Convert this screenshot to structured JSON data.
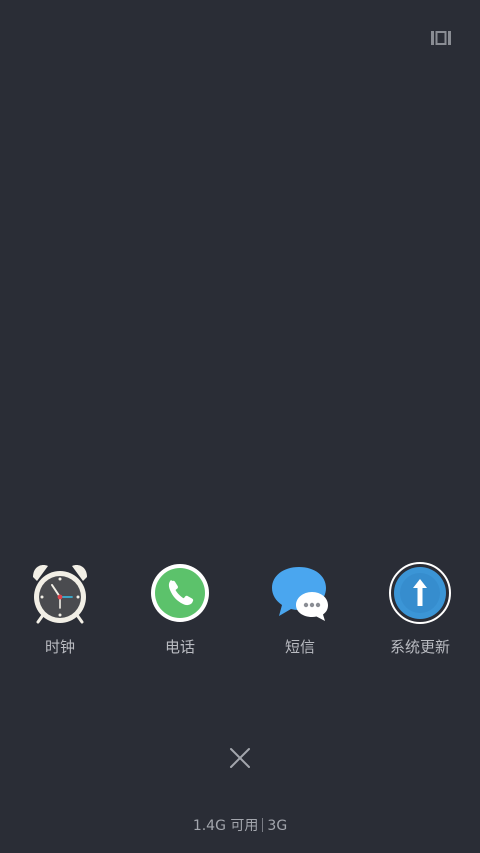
{
  "top_bar": {
    "layout_button_icon": "panel-switch-icon"
  },
  "recent_apps": [
    {
      "label": "时钟",
      "icon": "alarm-clock-icon"
    },
    {
      "label": "电话",
      "icon": "phone-icon"
    },
    {
      "label": "短信",
      "icon": "messages-icon"
    },
    {
      "label": "系统更新",
      "icon": "system-update-icon"
    }
  ],
  "close_all": {
    "icon": "close-icon"
  },
  "memory_status": {
    "available": "1.4G 可用",
    "network": "3G"
  },
  "colors": {
    "background": "#2a2d36",
    "label": "#b9bbc1",
    "phone_green": "#5cc26b",
    "message_blue": "#4aa6ef",
    "update_blue": "#3b95d6"
  }
}
